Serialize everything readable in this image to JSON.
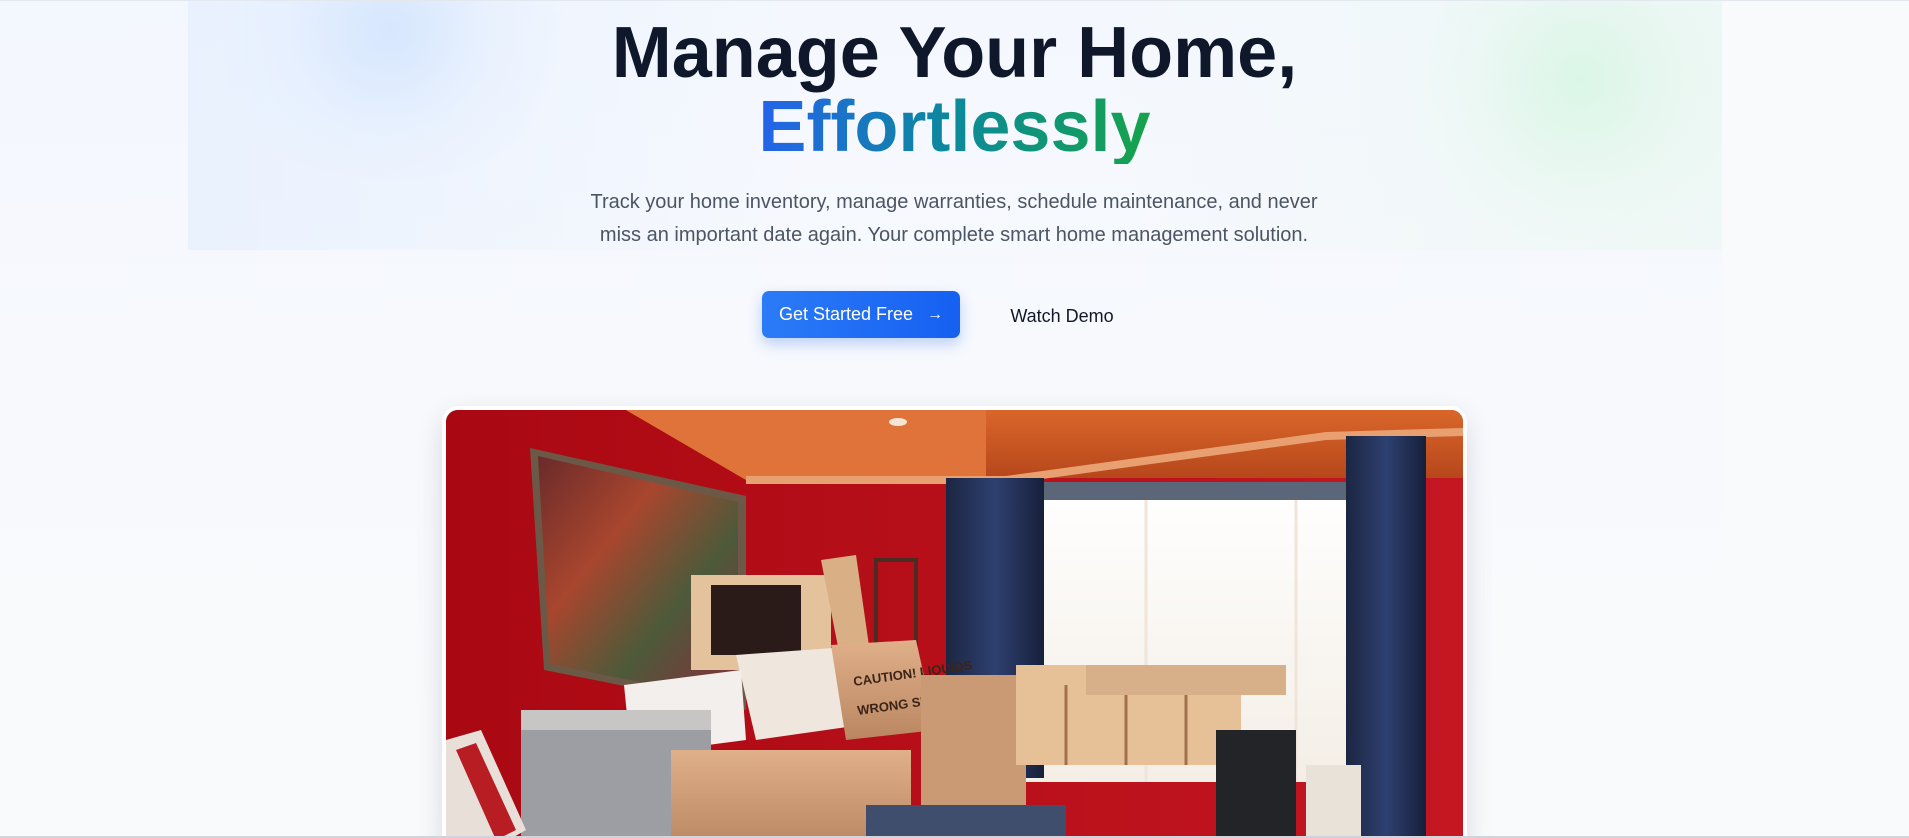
{
  "hero": {
    "headline_line1": "Manage Your Home,",
    "headline_line2": "Effortlessly",
    "subtitle_line1": "Track your home inventory, manage warranties, schedule maintenance, and never",
    "subtitle_line2": "miss an important date again. Your complete smart home management solution.",
    "primary_cta_label": "Get Started Free",
    "primary_cta_icon": "arrow-right-icon",
    "secondary_cta_label": "Watch Demo"
  },
  "hero_image": {
    "alt": "Room with red walls filled with moving boxes and furniture",
    "box_label_1": "CAUTION! LIQUIDS",
    "box_label_2": "WRONG SIDE UP"
  },
  "colors": {
    "headline": "#0f172a",
    "accent_gradient_start": "#2563eb",
    "accent_gradient_end": "#16a34a",
    "primary_button": "#1d6ef5",
    "subtitle": "#4b5563"
  }
}
